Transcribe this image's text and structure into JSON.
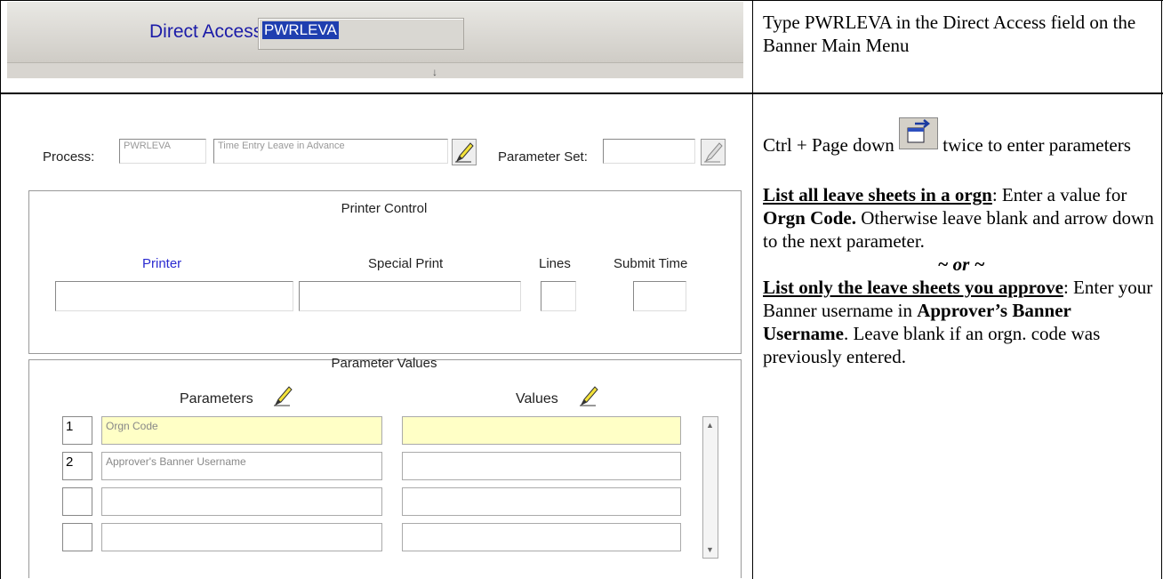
{
  "direct_access": {
    "label": "Direct Access:",
    "value": "PWRLEVA"
  },
  "instruction_1": "Type PWRLEVA in the Direct Access field on the Banner Main Menu",
  "instruction_2": {
    "part1": "Ctrl + Page down",
    "part2": "twice to enter parameters",
    "icon": "next-block-icon",
    "heading1": "List all leave sheets in a orgn",
    "text1a": ": Enter a value for ",
    "bold1": "Orgn Code.",
    "text1b": " Otherwise leave blank and arrow down to the next parameter.",
    "or": "~ or ~",
    "heading2": "List only the leave sheets you approve",
    "text2a": ":  Enter your Banner username in ",
    "bold2": "Approver’s Banner Username",
    "text2b": ".  Leave blank if an orgn. code was previously entered."
  },
  "form": {
    "process_label": "Process:",
    "process_code": "PWRLEVA",
    "process_desc": "Time Entry Leave in Advance",
    "param_set_label": "Parameter Set:",
    "param_set_value": "",
    "printer_control_title": "Printer Control",
    "printer_label": "Printer",
    "special_print_label": "Special Print",
    "lines_label": "Lines",
    "submit_time_label": "Submit Time",
    "parameter_values_title": "Parameter Values",
    "parameters_label": "Parameters",
    "values_label": "Values",
    "rows": [
      {
        "num": "1",
        "param": "Orgn Code",
        "value": ""
      },
      {
        "num": "2",
        "param": "Approver's Banner Username",
        "value": ""
      },
      {
        "num": "",
        "param": "",
        "value": ""
      },
      {
        "num": "",
        "param": "",
        "value": ""
      }
    ]
  }
}
